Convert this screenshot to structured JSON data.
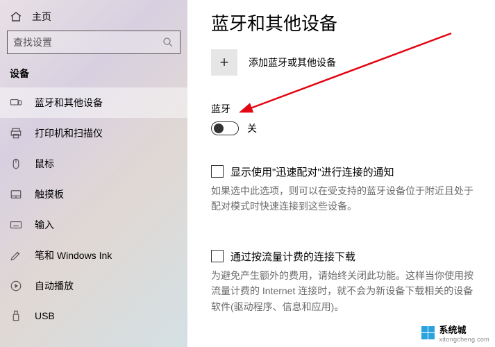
{
  "home_label": "主页",
  "search": {
    "placeholder": "查找设置"
  },
  "category_label": "设备",
  "sidebar": {
    "items": [
      {
        "label": "蓝牙和其他设备"
      },
      {
        "label": "打印机和扫描仪"
      },
      {
        "label": "鼠标"
      },
      {
        "label": "触摸板"
      },
      {
        "label": "输入"
      },
      {
        "label": "笔和 Windows Ink"
      },
      {
        "label": "自动播放"
      },
      {
        "label": "USB"
      }
    ]
  },
  "page_title": "蓝牙和其他设备",
  "add_device_label": "添加蓝牙或其他设备",
  "bluetooth": {
    "section_label": "蓝牙",
    "toggle_state": "关"
  },
  "quick_pair": {
    "label": "显示使用\"迅速配对\"进行连接的通知",
    "desc": "如果选中此选项，则可以在受支持的蓝牙设备位于附近且处于配对模式时快速连接到这些设备。"
  },
  "metered": {
    "label": "通过按流量计费的连接下载",
    "desc": "为避免产生额外的费用，请始终关闭此功能。这样当你使用按流量计费的 Internet 连接时，就不会为新设备下载相关的设备软件(驱动程序、信息和应用)。"
  },
  "watermark": {
    "brand": "系统城",
    "url": "xitongcheng.com"
  }
}
